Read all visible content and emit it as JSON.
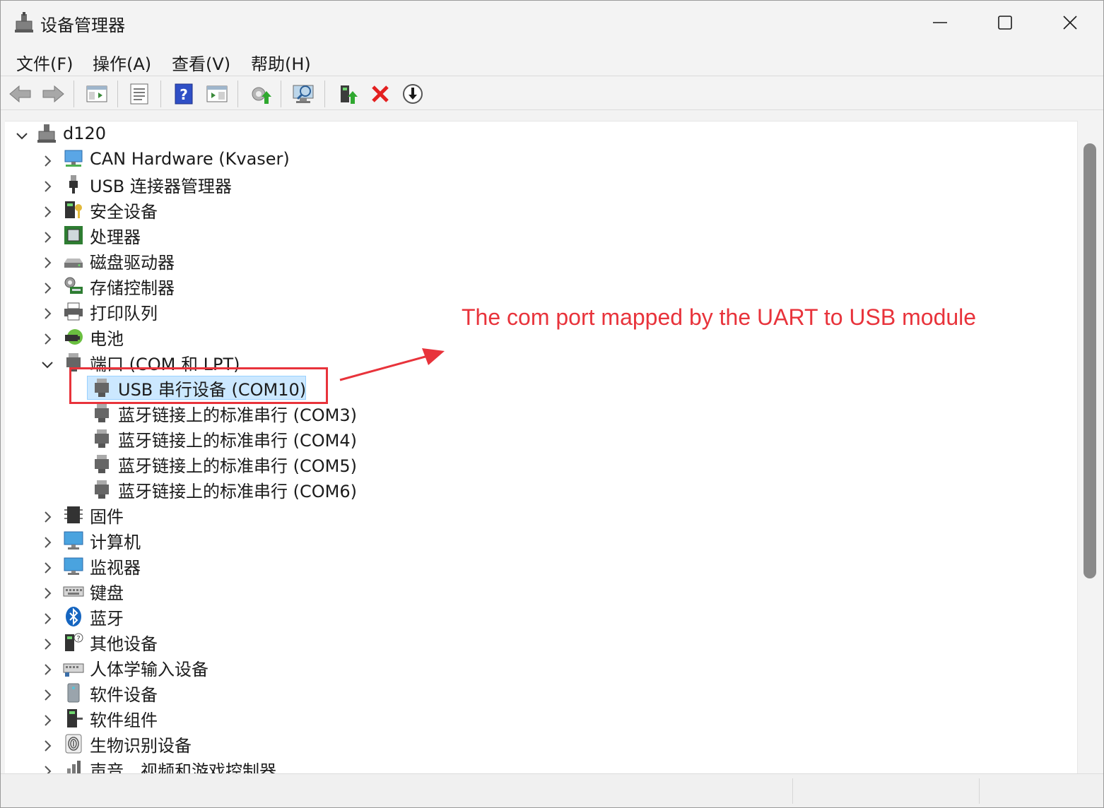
{
  "window": {
    "title": "设备管理器"
  },
  "menu": [
    {
      "label": "文件(F)"
    },
    {
      "label": "操作(A)"
    },
    {
      "label": "查看(V)"
    },
    {
      "label": "帮助(H)"
    }
  ],
  "toolbar": {
    "buttons": [
      "back-icon",
      "forward-icon",
      "show-hide-tree-icon",
      "properties-icon",
      "help-icon",
      "action-pane-icon",
      "update-driver-icon",
      "scan-hardware-icon",
      "enable-device-icon",
      "uninstall-icon",
      "disable-device-icon"
    ]
  },
  "tree": {
    "root": "d120",
    "categories_top": [
      {
        "label": "CAN Hardware (Kvaser)",
        "icon": "network-icon"
      },
      {
        "label": "USB 连接器管理器",
        "icon": "usb-icon"
      },
      {
        "label": "安全设备",
        "icon": "security-icon"
      },
      {
        "label": "处理器",
        "icon": "cpu-icon"
      },
      {
        "label": "磁盘驱动器",
        "icon": "disk-icon"
      },
      {
        "label": "存储控制器",
        "icon": "storage-icon"
      },
      {
        "label": "打印队列",
        "icon": "printer-icon"
      },
      {
        "label": "电池",
        "icon": "battery-icon"
      }
    ],
    "ports": {
      "label": "端口 (COM 和 LPT)",
      "children": [
        {
          "label": "USB 串行设备 (COM10)",
          "selected": true
        },
        {
          "label": "蓝牙链接上的标准串行 (COM3)"
        },
        {
          "label": "蓝牙链接上的标准串行 (COM4)"
        },
        {
          "label": "蓝牙链接上的标准串行 (COM5)"
        },
        {
          "label": "蓝牙链接上的标准串行 (COM6)"
        }
      ]
    },
    "categories_bottom": [
      {
        "label": "固件",
        "icon": "firmware-icon"
      },
      {
        "label": "计算机",
        "icon": "computer-icon"
      },
      {
        "label": "监视器",
        "icon": "monitor-icon"
      },
      {
        "label": "键盘",
        "icon": "keyboard-icon"
      },
      {
        "label": "蓝牙",
        "icon": "bluetooth-icon"
      },
      {
        "label": "其他设备",
        "icon": "unknown-device-icon"
      },
      {
        "label": "人体学输入设备",
        "icon": "hid-icon"
      },
      {
        "label": "软件设备",
        "icon": "software-device-icon"
      },
      {
        "label": "软件组件",
        "icon": "software-component-icon"
      },
      {
        "label": "生物识别设备",
        "icon": "fingerprint-icon"
      },
      {
        "label": "声音、视频和游戏控制器",
        "icon": "sound-icon"
      }
    ]
  },
  "annotation": {
    "text": "The com port mapped by the UART to USB module",
    "color": "#e8333b"
  },
  "colors": {
    "selection": "#cce8ff",
    "selection_border": "#99d1ff",
    "annotation": "#e8333b"
  }
}
